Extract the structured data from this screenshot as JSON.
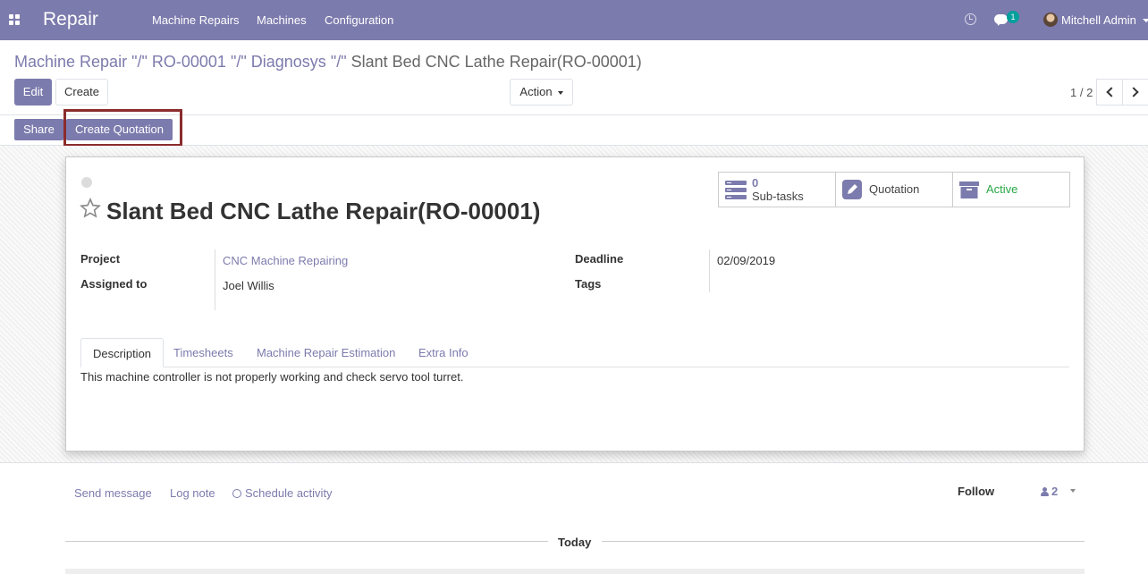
{
  "navbar": {
    "app_title": "Repair",
    "menus": [
      "Machine Repairs",
      "Machines",
      "Configuration"
    ],
    "chat_count": "1",
    "user_name": "Mitchell Admin"
  },
  "breadcrumb": {
    "crumbs": [
      "Machine Repair",
      "RO-00001",
      "Diagnosys"
    ],
    "separator": "\"/\"",
    "current": "Slant Bed CNC Lathe Repair(RO-00001)"
  },
  "toolbar": {
    "edit_label": "Edit",
    "create_label": "Create",
    "action_label": "Action",
    "pager_value": "1 / 2"
  },
  "statusbar": {
    "share_label": "Share",
    "create_quotation_label": "Create Quotation"
  },
  "record": {
    "title": "Slant Bed CNC Lathe Repair(RO-00001)",
    "smart_buttons": {
      "subtasks_count": "0",
      "subtasks_label": "Sub-tasks",
      "quotation_label": "Quotation",
      "active_label": "Active"
    },
    "fields": {
      "project_label": "Project",
      "project_value": "CNC Machine Repairing",
      "assigned_label": "Assigned to",
      "assigned_value": "Joel Willis",
      "deadline_label": "Deadline",
      "deadline_value": "02/09/2019",
      "tags_label": "Tags"
    },
    "tabs": [
      "Description",
      "Timesheets",
      "Machine Repair Estimation",
      "Extra Info"
    ],
    "description": "This machine controller is not properly working and check servo tool turret."
  },
  "chatter": {
    "send_message": "Send message",
    "log_note": "Log note",
    "schedule_activity": "Schedule activity",
    "follow_label": "Follow",
    "followers_count": "2",
    "today_label": "Today"
  },
  "colors": {
    "brand": "#7c7bad",
    "highlight_box": "#8b2c2c",
    "active_green": "#28a745",
    "badge": "#00a09d"
  }
}
